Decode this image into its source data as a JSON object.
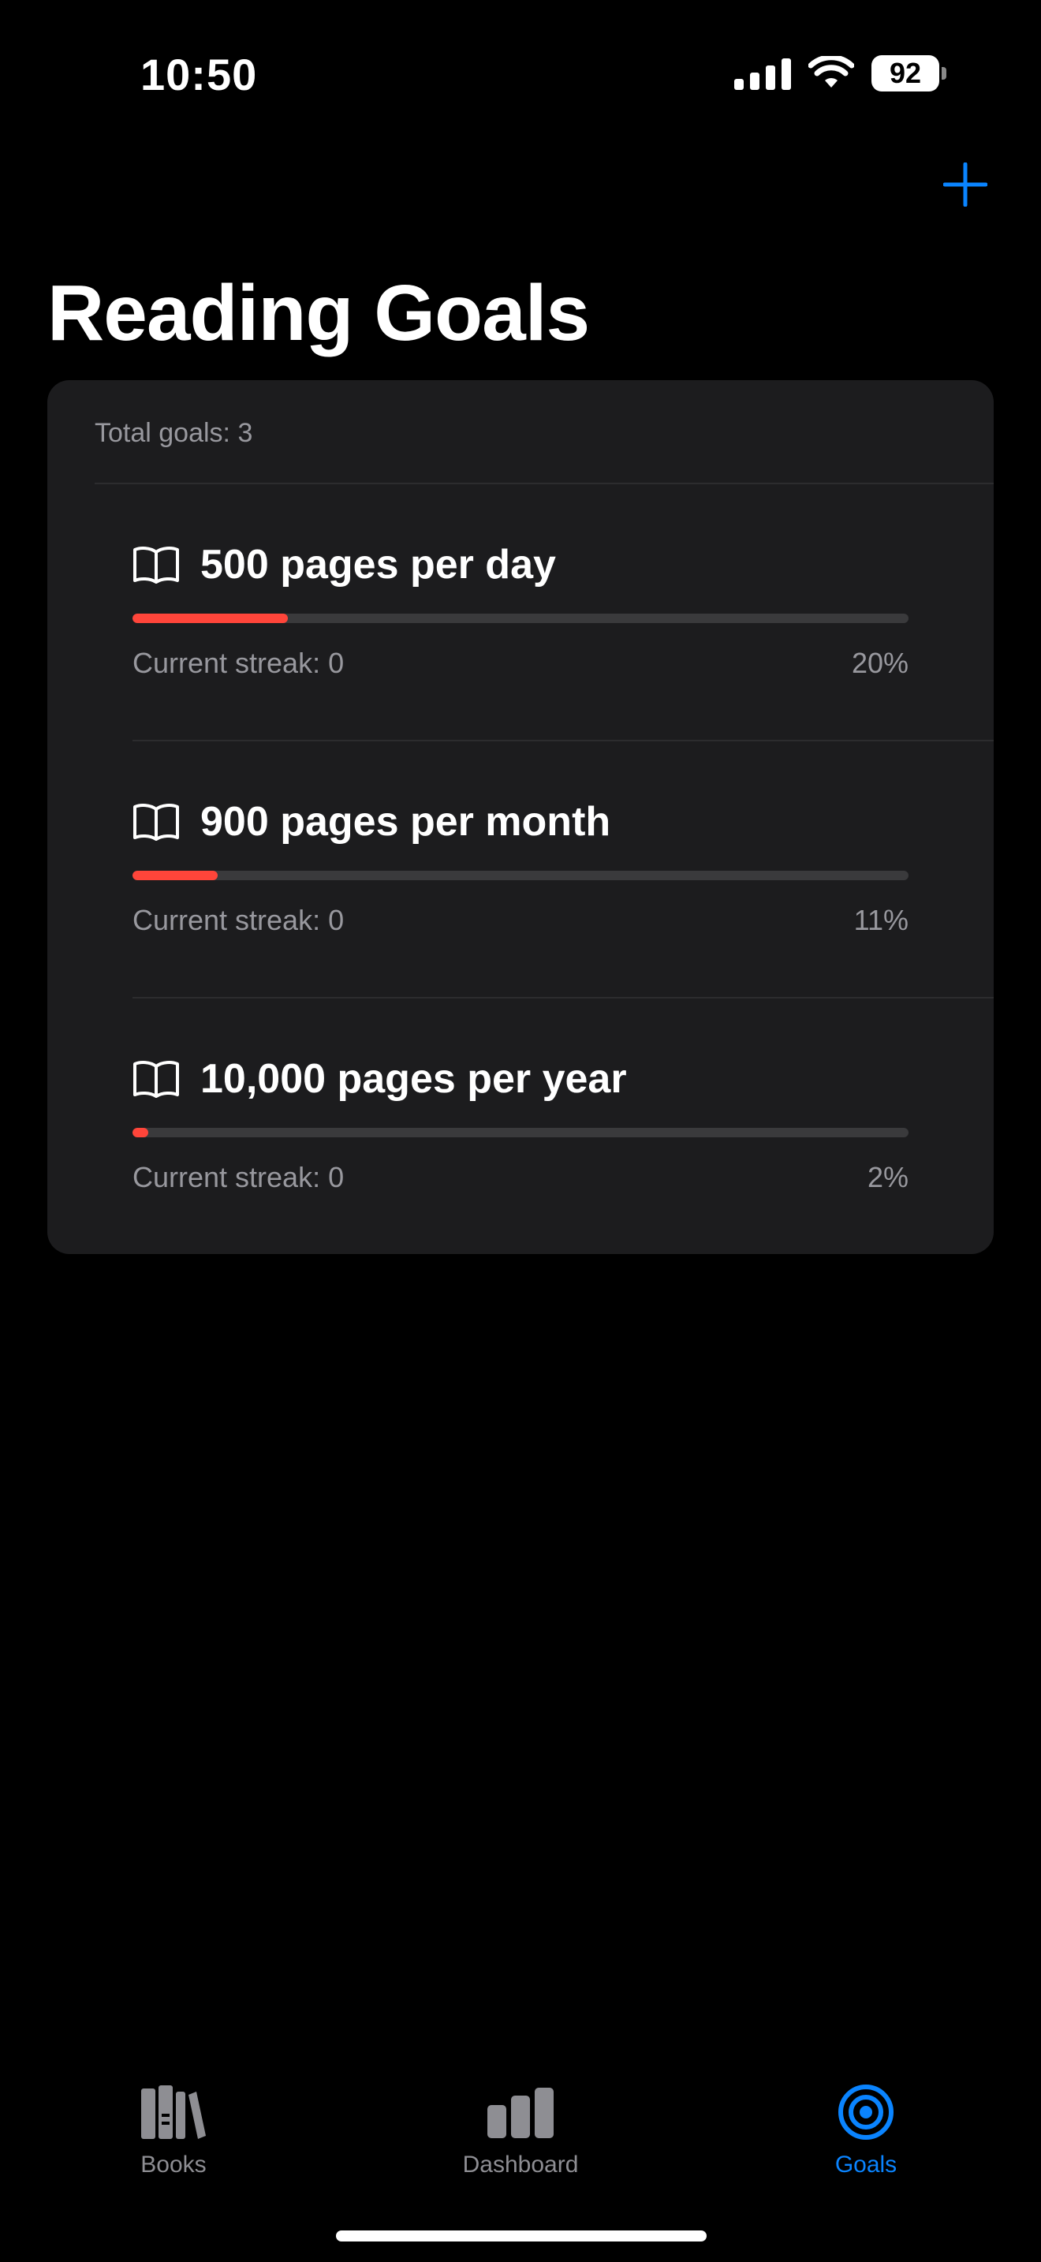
{
  "status_bar": {
    "time": "10:50",
    "battery": "92"
  },
  "header": {
    "title": "Reading Goals",
    "add_icon": "plus-icon"
  },
  "card": {
    "total_goals": "Total goals: 3",
    "goals": [
      {
        "title": "500 pages per day",
        "streak": "Current streak: 0",
        "percent_label": "20%",
        "progress": 0.2,
        "icon": "book-icon"
      },
      {
        "title": "900 pages per month",
        "streak": "Current streak: 0",
        "percent_label": "11%",
        "progress": 0.11,
        "icon": "book-icon"
      },
      {
        "title": "10,000 pages per year",
        "streak": "Current streak: 0",
        "percent_label": "2%",
        "progress": 0.02,
        "icon": "book-icon"
      }
    ]
  },
  "tab_bar": {
    "tabs": [
      {
        "label": "Books",
        "icon": "books-icon",
        "active": false
      },
      {
        "label": "Dashboard",
        "icon": "bar-chart-icon",
        "active": false
      },
      {
        "label": "Goals",
        "icon": "target-icon",
        "active": true
      }
    ]
  },
  "colors": {
    "accent": "#0a84ff",
    "progress": "#ff453a",
    "card": "#1c1c1e",
    "track": "#3a3a3c",
    "secondary_text": "#98989e"
  }
}
